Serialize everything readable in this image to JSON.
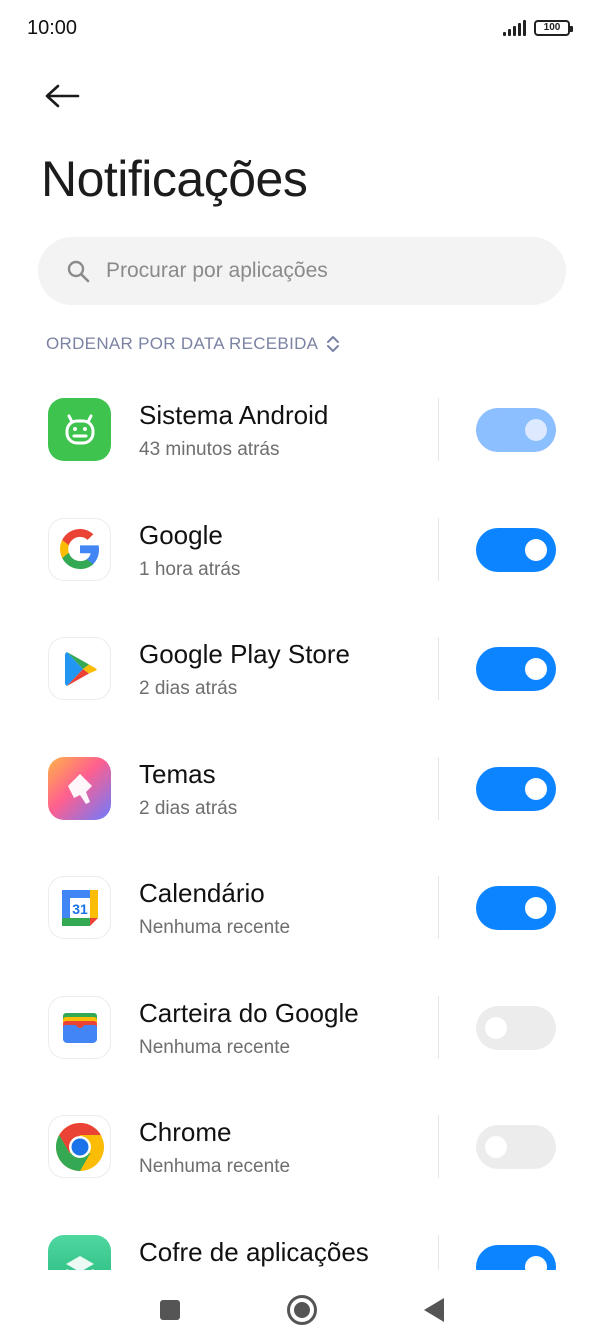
{
  "status_bar": {
    "time": "10:00",
    "battery": "100",
    "icons": [
      "signal-icon",
      "battery-icon"
    ]
  },
  "header": {
    "back_icon": "arrow-left-icon",
    "title": "Notificações"
  },
  "search": {
    "placeholder": "Procurar por aplicações",
    "icon": "search-icon"
  },
  "sort": {
    "label": "ORDENAR POR DATA RECEBIDA",
    "icon": "chevron-updown-icon"
  },
  "colors": {
    "accent": "#0d84ff",
    "accent_disabled": "#8bbfff",
    "toggle_off": "#ececec",
    "sort_label": "#7b83a3"
  },
  "apps": [
    {
      "name": "Sistema Android",
      "subtitle": "43 minutos atrás",
      "icon": "android-system-icon",
      "toggle": "on-disabled"
    },
    {
      "name": "Google",
      "subtitle": "1 hora atrás",
      "icon": "google-icon",
      "toggle": "on"
    },
    {
      "name": "Google Play Store",
      "subtitle": "2 dias atrás",
      "icon": "play-store-icon",
      "toggle": "on"
    },
    {
      "name": "Temas",
      "subtitle": "2 dias atrás",
      "icon": "themes-icon",
      "toggle": "on"
    },
    {
      "name": "Calendário",
      "subtitle": "Nenhuma recente",
      "icon": "calendar-icon",
      "icon_text": "31",
      "toggle": "on"
    },
    {
      "name": "Carteira do Google",
      "subtitle": "Nenhuma recente",
      "icon": "wallet-icon",
      "toggle": "off"
    },
    {
      "name": "Chrome",
      "subtitle": "Nenhuma recente",
      "icon": "chrome-icon",
      "toggle": "off"
    },
    {
      "name": "Cofre de aplicações",
      "subtitle": "",
      "icon": "app-vault-icon",
      "toggle": "on"
    }
  ],
  "nav": {
    "buttons": [
      "recents-square-icon",
      "home-circle-icon",
      "back-triangle-icon"
    ]
  }
}
